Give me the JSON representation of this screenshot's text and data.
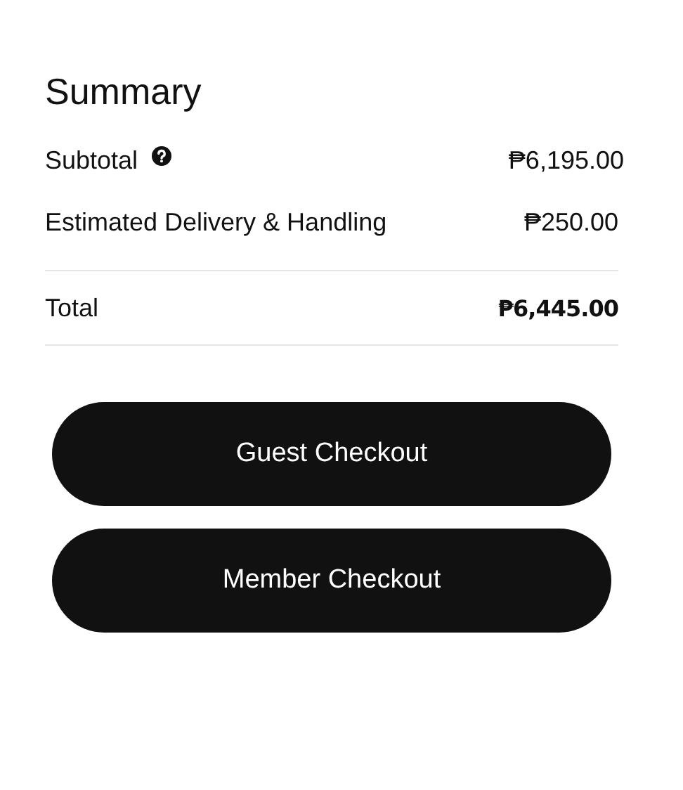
{
  "title": "Summary",
  "rows": [
    {
      "kind": "line",
      "label": "Subtotal",
      "help": true,
      "value": "₱6,195.00"
    },
    {
      "kind": "line",
      "label": "Estimated Delivery & Handling",
      "help": false,
      "value": "₱250.00"
    },
    {
      "kind": "total",
      "label": "Total",
      "help": false,
      "value": "₱6,445.00"
    }
  ],
  "buttons": [
    "Guest Checkout",
    "Member Checkout"
  ]
}
